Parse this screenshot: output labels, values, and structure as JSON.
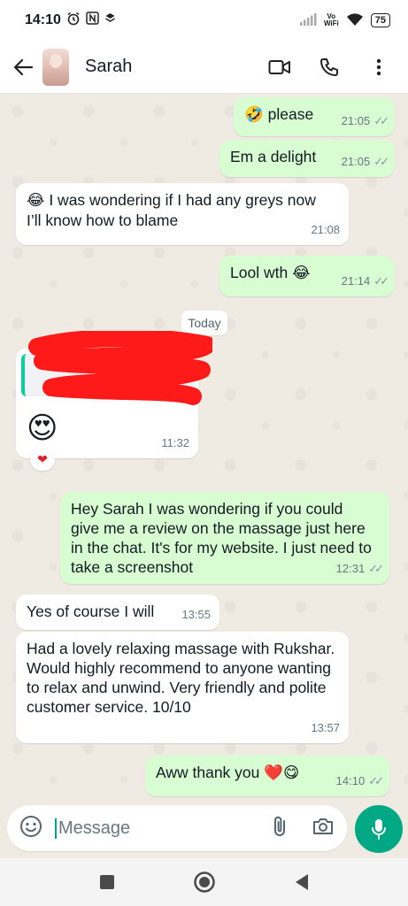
{
  "status_bar": {
    "time": "14:10",
    "battery": "75",
    "vowifi_top": "Vo",
    "vowifi_bottom": "WiFi"
  },
  "header": {
    "contact_name": "Sarah"
  },
  "messages": [
    {
      "dir": "out",
      "emoji": "🤣",
      "text": "please",
      "time": "21:05"
    },
    {
      "dir": "out",
      "text": "Em a delight",
      "time": "21:05"
    },
    {
      "dir": "in",
      "emoji": "😂",
      "text": "I was wondering if I had any greys now I’ll know how to blame",
      "time": "21:08"
    },
    {
      "dir": "out",
      "text": "Lool wth",
      "emoji": "😂",
      "time": "21:14"
    },
    {
      "dir": "in",
      "emoji": "😍",
      "time": "11:32",
      "reaction": "❤"
    },
    {
      "dir": "out",
      "text": "Hey Sarah I was wondering if you could give me a review on the massage just here in the chat. It's for my website. I just need to take a screenshot",
      "time": "12:31"
    },
    {
      "dir": "in",
      "text": "Yes of course I will",
      "time": "13:55"
    },
    {
      "dir": "in",
      "text": "Had a lovely relaxing massage with Rukshar. Would highly recommend to anyone wanting to relax and unwind. Very friendly and polite customer service. 10/10",
      "time": "13:57"
    },
    {
      "dir": "out",
      "text": "Aww thank you",
      "emoji": "❤️😋",
      "time": "14:10"
    }
  ],
  "date_separator": "Today",
  "composer": {
    "placeholder": "Message"
  },
  "colors": {
    "outgoing": "#d9fdd3",
    "incoming": "#ffffff",
    "accent": "#00a884",
    "background": "#efeae2"
  }
}
